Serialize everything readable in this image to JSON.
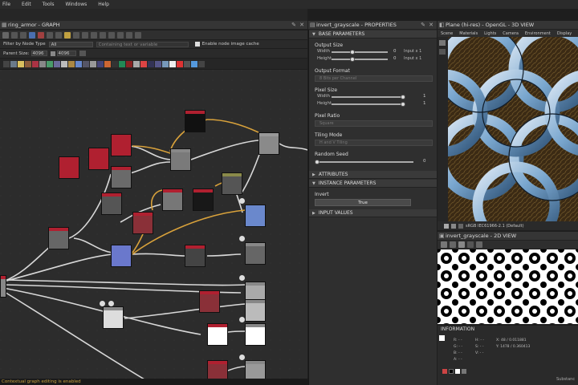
{
  "menu": [
    "File",
    "Edit",
    "Tools",
    "Windows",
    "Help"
  ],
  "graph": {
    "title": "ring_armor - GRAPH",
    "filter_label": "Filter by Node Type",
    "filter_value": "All",
    "search_placeholder": "Containing text or variable",
    "cache_label": "Enable node image cache",
    "parent_size_label": "Parent Size:",
    "parent_size_value": "4096",
    "size_value": "4096"
  },
  "properties": {
    "title": "invert_grayscale - PROPERTIES",
    "base_parameters": "BASE PARAMETERS",
    "output_size": "Output Size",
    "width_label": "Width",
    "height_label": "Height",
    "width_value": "0",
    "height_value": "0",
    "width_rel": "Input x 1",
    "height_rel": "Input x 1",
    "output_format": "Output Format",
    "output_format_value": "8 Bits per Channel",
    "pixel_size": "Pixel Size",
    "pixel_width": "1",
    "pixel_height": "1",
    "pixel_ratio": "Pixel Ratio",
    "pixel_ratio_value": "Square",
    "tiling_mode": "Tiling Mode",
    "tiling_value": "H and V Tiling",
    "random_seed": "Random Seed",
    "random_seed_value": "0",
    "attributes": "ATTRIBUTES",
    "instance_parameters": "INSTANCE PARAMETERS",
    "invert_label": "Invert",
    "invert_value": "True",
    "input_values": "INPUT VALUES"
  },
  "view3d": {
    "title": "Plane (hi-res) - OpenGL - 3D VIEW",
    "tabs": [
      "Scene",
      "Materials",
      "Lights",
      "Camera",
      "Environment",
      "Display",
      "Re"
    ],
    "colorspace": "sRGB IEC61966-2.1 (Default)"
  },
  "view2d": {
    "title": "invert_grayscale - 2D VIEW",
    "info_title": "INFORMATION",
    "r": "R: - -",
    "g": "G: - -",
    "b": "B: - -",
    "a": "A: - -",
    "h": "H: - -",
    "s": "S: - -",
    "v": "V: - -",
    "x": "X:  48 / 0.011881",
    "y": "Y: 1478 / 0.360413",
    "substance": "Substanc"
  },
  "status": "Contextual graph editing is enabled",
  "colors": {
    "accent": "#d9a23b",
    "link": "#e0e0e0",
    "red_node": "#b02030"
  }
}
